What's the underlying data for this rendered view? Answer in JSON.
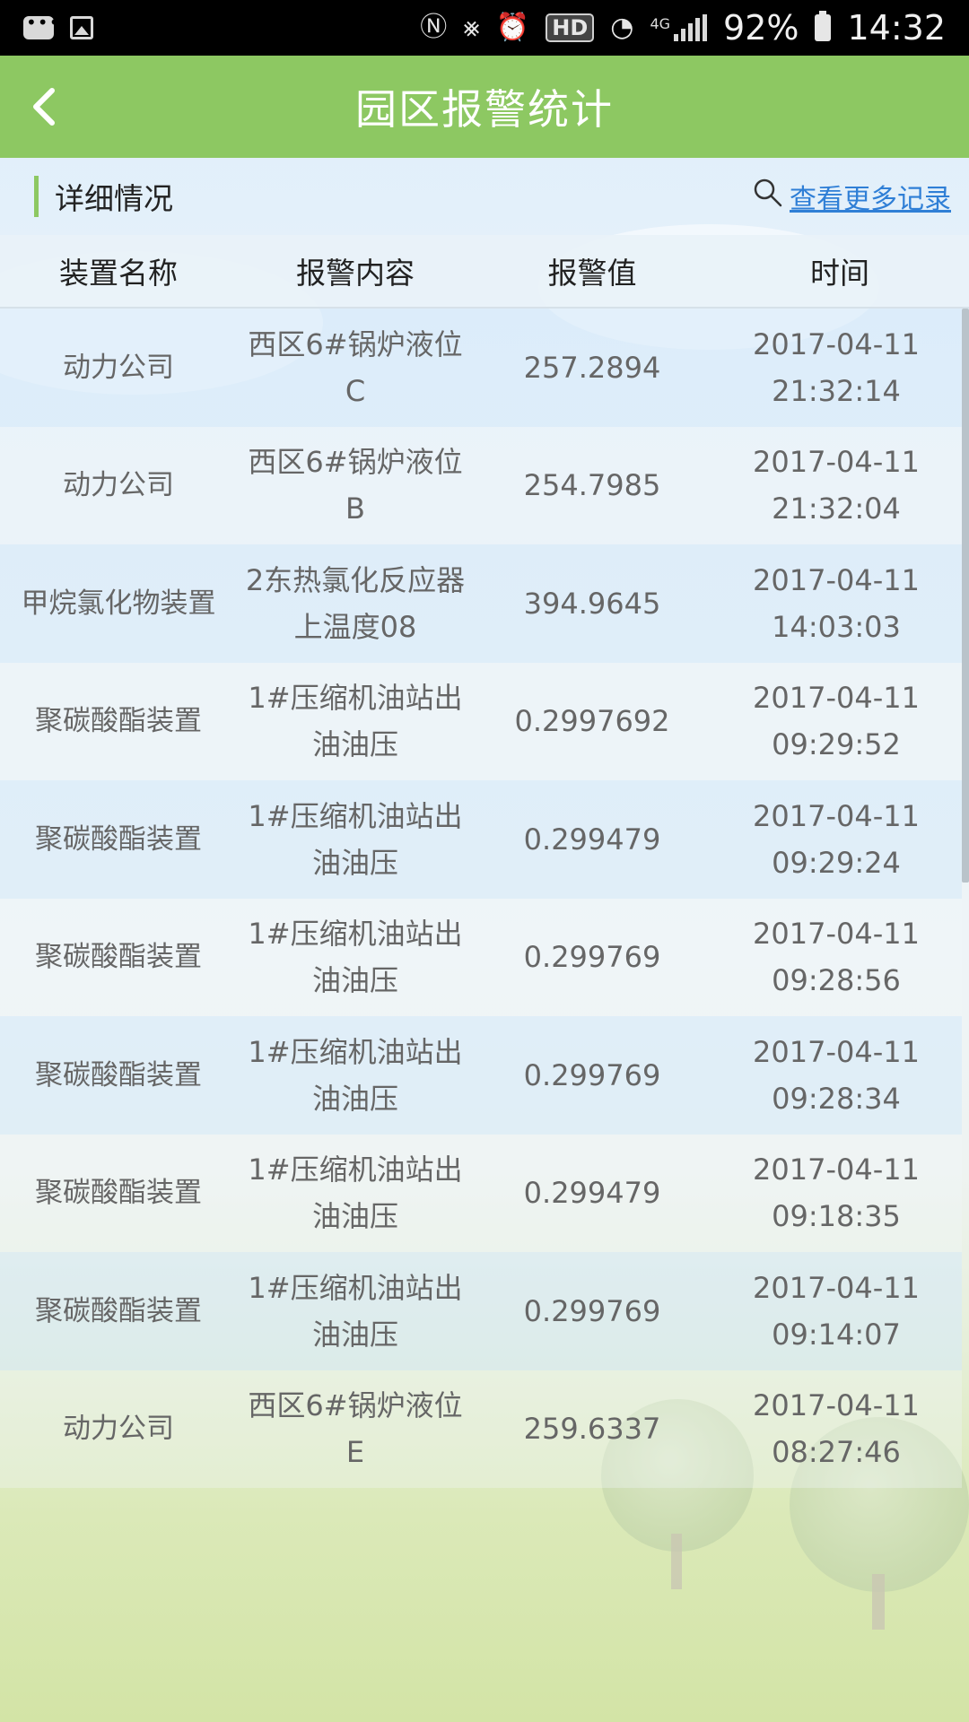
{
  "status_bar": {
    "time": "14:32",
    "battery": "92%",
    "network": "4G",
    "hd": "HD",
    "icons": [
      "message-icon",
      "image-icon",
      "nfc-icon",
      "mute-vibrate-icon",
      "alarm-icon",
      "hd-icon",
      "wifi-icon",
      "signal-icon",
      "battery-icon"
    ]
  },
  "header": {
    "title": "园区报警统计",
    "back_icon": "back-arrow-icon"
  },
  "section": {
    "title": "详细情况",
    "more_link": "查看更多记录",
    "search_icon": "search-icon"
  },
  "table": {
    "columns": [
      "装置名称",
      "报警内容",
      "报警值",
      "时间"
    ],
    "rows": [
      {
        "device": "动力公司",
        "content": "西区6#锅炉液位C",
        "value": "257.2894",
        "date": "2017-04-11",
        "time": "21:32:14"
      },
      {
        "device": "动力公司",
        "content": "西区6#锅炉液位B",
        "value": "254.7985",
        "date": "2017-04-11",
        "time": "21:32:04"
      },
      {
        "device": "甲烷氯化物装置",
        "content": "2东热氯化反应器上温度08",
        "value": "394.9645",
        "date": "2017-04-11",
        "time": "14:03:03"
      },
      {
        "device": "聚碳酸酯装置",
        "content": "1#压缩机油站出油油压",
        "value": "0.2997692",
        "date": "2017-04-11",
        "time": "09:29:52"
      },
      {
        "device": "聚碳酸酯装置",
        "content": "1#压缩机油站出油油压",
        "value": "0.299479",
        "date": "2017-04-11",
        "time": "09:29:24"
      },
      {
        "device": "聚碳酸酯装置",
        "content": "1#压缩机油站出油油压",
        "value": "0.299769",
        "date": "2017-04-11",
        "time": "09:28:56"
      },
      {
        "device": "聚碳酸酯装置",
        "content": "1#压缩机油站出油油压",
        "value": "0.299769",
        "date": "2017-04-11",
        "time": "09:28:34"
      },
      {
        "device": "聚碳酸酯装置",
        "content": "1#压缩机油站出油油压",
        "value": "0.299479",
        "date": "2017-04-11",
        "time": "09:18:35"
      },
      {
        "device": "聚碳酸酯装置",
        "content": "1#压缩机油站出油油压",
        "value": "0.299769",
        "date": "2017-04-11",
        "time": "09:14:07"
      },
      {
        "device": "动力公司",
        "content": "西区6#锅炉液位E",
        "value": "259.6337",
        "date": "2017-04-11",
        "time": "08:27:46"
      }
    ]
  },
  "colors": {
    "header_green": "#8dc862",
    "link_blue": "#2f7fd6",
    "text_gray": "#666666"
  }
}
